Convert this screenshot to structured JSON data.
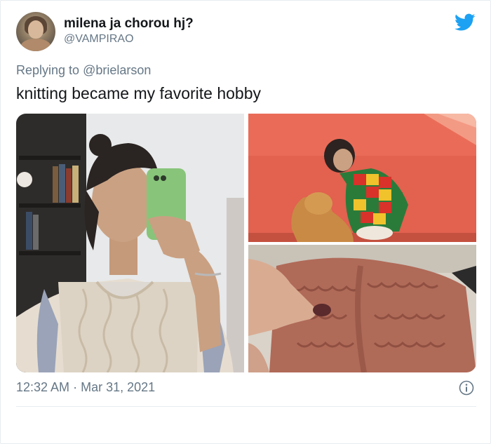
{
  "tweet": {
    "author_name": "milena ja chorou hj?",
    "author_handle": "@VAMPIRAO",
    "replying_prefix": "Replying to",
    "replying_to": "@brielarson",
    "text": "knitting became my favorite hobby",
    "time": "12:32 AM",
    "separator": "·",
    "date": "Mar 31, 2021"
  },
  "icons": {
    "brand": "twitter-bird-icon",
    "info": "info-icon"
  },
  "colors": {
    "brand_blue": "#1da1f2",
    "secondary_text": "#657786",
    "primary_text": "#14171a"
  }
}
